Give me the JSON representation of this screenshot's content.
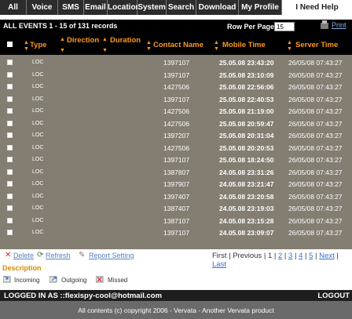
{
  "tabs": [
    "All",
    "Voice",
    "SMS",
    "Email",
    "Location",
    "System",
    "Search",
    "Download",
    "My Profile",
    "I Need Help"
  ],
  "events_title": "ALL EVENTS 1 - 15 of 131 records",
  "rows_per_page_label": "Row Per Page",
  "rows_per_page_value": "15",
  "print_label": "Print",
  "columns": {
    "type": "Type",
    "direction": "Direction",
    "duration": "Duration",
    "contact": "Contact Name",
    "mobile": "Mobile Time",
    "server": "Server Time"
  },
  "rows": [
    {
      "type": "LOC",
      "contact": "1397107",
      "mobile": "25.05.08 23:43:20",
      "server": "26/05/08 07:43:27"
    },
    {
      "type": "LOC",
      "contact": "1397107",
      "mobile": "25.05.08 23:10:09",
      "server": "26/05/08 07:43:27"
    },
    {
      "type": "LOC",
      "contact": "1427506",
      "mobile": "25.05.08 22:56:06",
      "server": "26/05/08 07:43:27"
    },
    {
      "type": "LOC",
      "contact": "1397107",
      "mobile": "25.05.08 22:40:53",
      "server": "26/05/08 07:43:27"
    },
    {
      "type": "LOC",
      "contact": "1427506",
      "mobile": "25.05.08 21:19:00",
      "server": "26/05/08 07:43:27"
    },
    {
      "type": "LOC",
      "contact": "1427506",
      "mobile": "25.05.08 20:59:47",
      "server": "26/05/08 07:43:27"
    },
    {
      "type": "LOC",
      "contact": "1397207",
      "mobile": "25.05.08 20:31:04",
      "server": "26/05/08 07:43:27"
    },
    {
      "type": "LOC",
      "contact": "1427506",
      "mobile": "25.05.08 20:20:53",
      "server": "26/05/08 07:43:27"
    },
    {
      "type": "LOC",
      "contact": "1397107",
      "mobile": "25.05.08 18:24:50",
      "server": "26/05/08 07:43:27"
    },
    {
      "type": "LOC",
      "contact": "1387807",
      "mobile": "24.05.08 23:31:26",
      "server": "26/05/08 07:43:27"
    },
    {
      "type": "LOC",
      "contact": "1397907",
      "mobile": "24.05.08 23:21:47",
      "server": "26/05/08 07:43:27"
    },
    {
      "type": "LOC",
      "contact": "1397407",
      "mobile": "24.05.08 23:20:58",
      "server": "26/05/08 07:43:27"
    },
    {
      "type": "LOC",
      "contact": "1387407",
      "mobile": "24.05.08 23:19:03",
      "server": "26/05/08 07:43:27"
    },
    {
      "type": "LOC",
      "contact": "1387107",
      "mobile": "24.05.08 23:15:28",
      "server": "26/05/08 07:43:27"
    },
    {
      "type": "LOC",
      "contact": "1397107",
      "mobile": "24.05.08 23:09:07",
      "server": "26/05/08 07:43:27"
    }
  ],
  "toolbar": {
    "delete": "Delete",
    "refresh": "Refresh",
    "report_setting": "Report Setting"
  },
  "pager": {
    "first": "First",
    "previous": "Previous",
    "pages": [
      "1",
      "2",
      "3",
      "4",
      "5"
    ],
    "current": "1",
    "next": "Next",
    "last": "Last"
  },
  "description_title": "Description",
  "legend": {
    "incoming": "Incoming",
    "outgoing": "Outgoing",
    "missed": "Missed"
  },
  "logged_in_as": "LOGGED IN AS ::flexispy-cool@hotmail.com",
  "logout": "LOGOUT",
  "copyright": "All contents (c) copyright 2006 - Vervata - Another Vervata product",
  "colors": {
    "accent": "#ff9a1a",
    "table_bg": "#837d72",
    "header_bg": "#000000",
    "link": "#3a6dc8"
  },
  "icons": {
    "delete": "x-icon",
    "refresh": "refresh-icon",
    "report_setting": "wrench-icon",
    "print": "printer-icon"
  }
}
